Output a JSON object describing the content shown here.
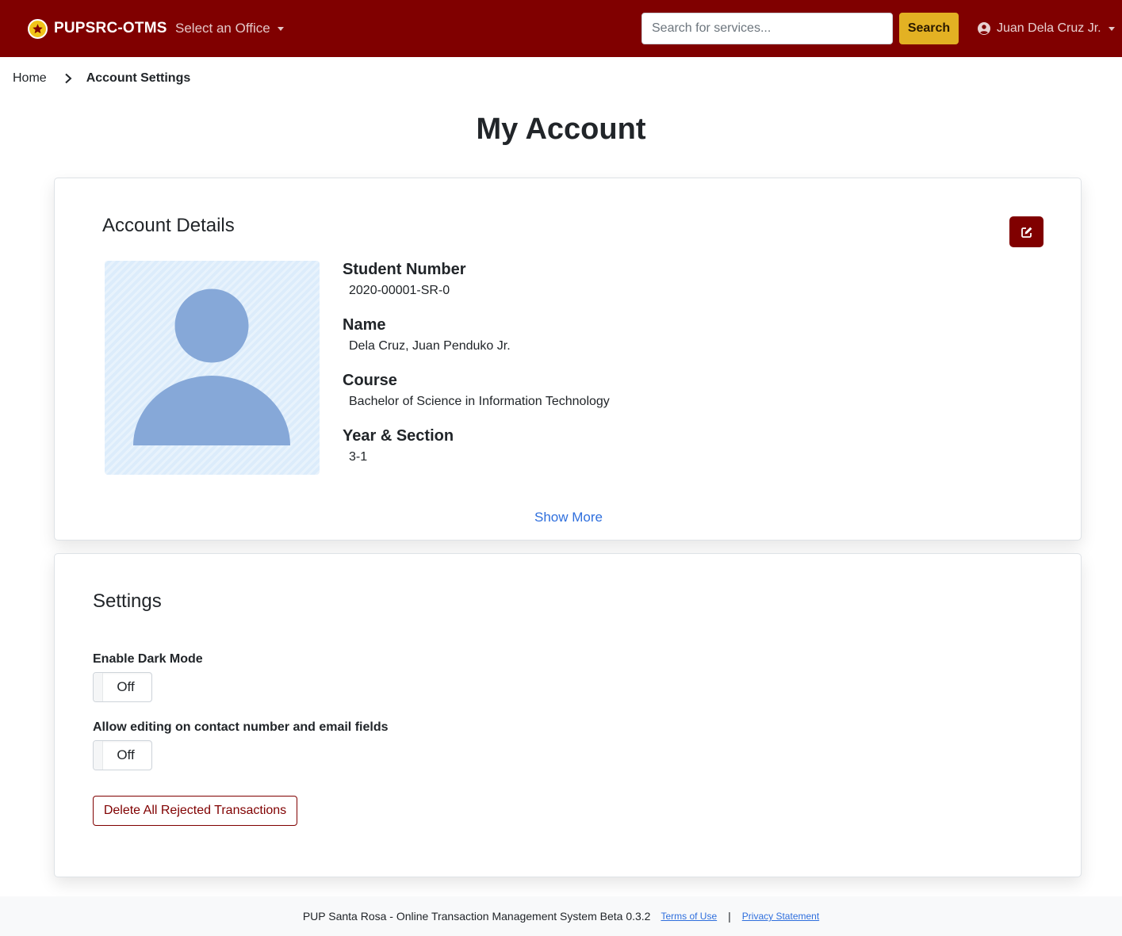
{
  "navbar": {
    "brand": "PUPSRC-OTMS",
    "office_select": "Select an Office",
    "search_placeholder": "Search for services...",
    "search_button": "Search",
    "user_name": "Juan Dela Cruz Jr."
  },
  "breadcrumb": {
    "home": "Home",
    "current": "Account Settings"
  },
  "page_title": "My Account",
  "account": {
    "title": "Account Details",
    "fields": [
      {
        "label": "Student Number",
        "value": "2020-00001-SR-0"
      },
      {
        "label": "Name",
        "value": "Dela Cruz, Juan Penduko Jr."
      },
      {
        "label": "Course",
        "value": "Bachelor of Science in Information Technology"
      },
      {
        "label": "Year & Section",
        "value": "3-1"
      }
    ],
    "show_more": "Show More"
  },
  "settings": {
    "title": "Settings",
    "dark_mode_label": "Enable Dark Mode",
    "dark_mode_state": "Off",
    "allow_edit_label": "Allow editing on contact number and email fields",
    "allow_edit_state": "Off",
    "delete_button": "Delete All Rejected Transactions"
  },
  "footer": {
    "text": "PUP Santa Rosa - Online Transaction Management System Beta 0.3.2",
    "terms": "Terms of Use",
    "separator": "|",
    "privacy": "Privacy Statement"
  },
  "colors": {
    "brand": "#800000",
    "accent": "#e3b123",
    "link": "#2f6fdd",
    "avatar_bg": "#dcecfb",
    "avatar_figure": "#86a8d8"
  },
  "icons": {
    "brand": "star-seal-icon",
    "office": "chevron-down-icon",
    "user": "user-circle-icon",
    "breadcrumb": "chevron-right-icon",
    "edit": "edit-icon",
    "avatar": "user-placeholder-icon"
  }
}
